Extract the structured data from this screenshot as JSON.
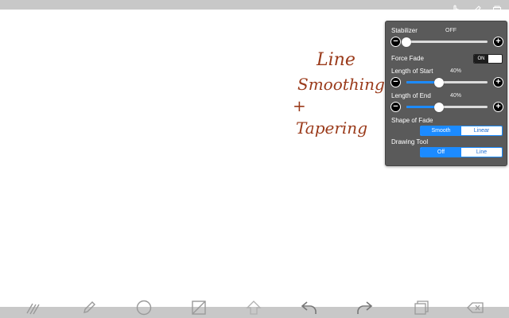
{
  "canvas": {
    "handwriting": [
      "Line",
      "Smoothing",
      "+",
      "Tapering"
    ],
    "ink_color": "#9a3a1a"
  },
  "top_tools": [
    "touch-icon",
    "pen-icon",
    "layer-icon"
  ],
  "settings": {
    "stabilizer": {
      "label": "Stabilizer",
      "value": "OFF",
      "level": 0.0
    },
    "force_fade": {
      "label": "Force Fade",
      "state": "ON"
    },
    "length_of_start": {
      "label": "Length of Start",
      "value": "40%",
      "level": 0.4
    },
    "length_of_end": {
      "label": "Length of End",
      "value": "40%",
      "level": 0.4
    },
    "shape_of_fade": {
      "label": "Shape of Fade",
      "options": [
        "Smooth",
        "Linear"
      ],
      "selected": "Smooth"
    },
    "drawing_tool": {
      "label": "Drawing Tool",
      "options": [
        "Off",
        "Line"
      ],
      "selected": "Off"
    }
  },
  "bottom_tools": [
    "brush-select-icon",
    "pencil-icon",
    "circle-icon",
    "square-slash-icon",
    "upload-icon",
    "undo-icon",
    "redo-icon",
    "layers-icon",
    "eraser-icon"
  ],
  "accent_color": "#1c8bff"
}
